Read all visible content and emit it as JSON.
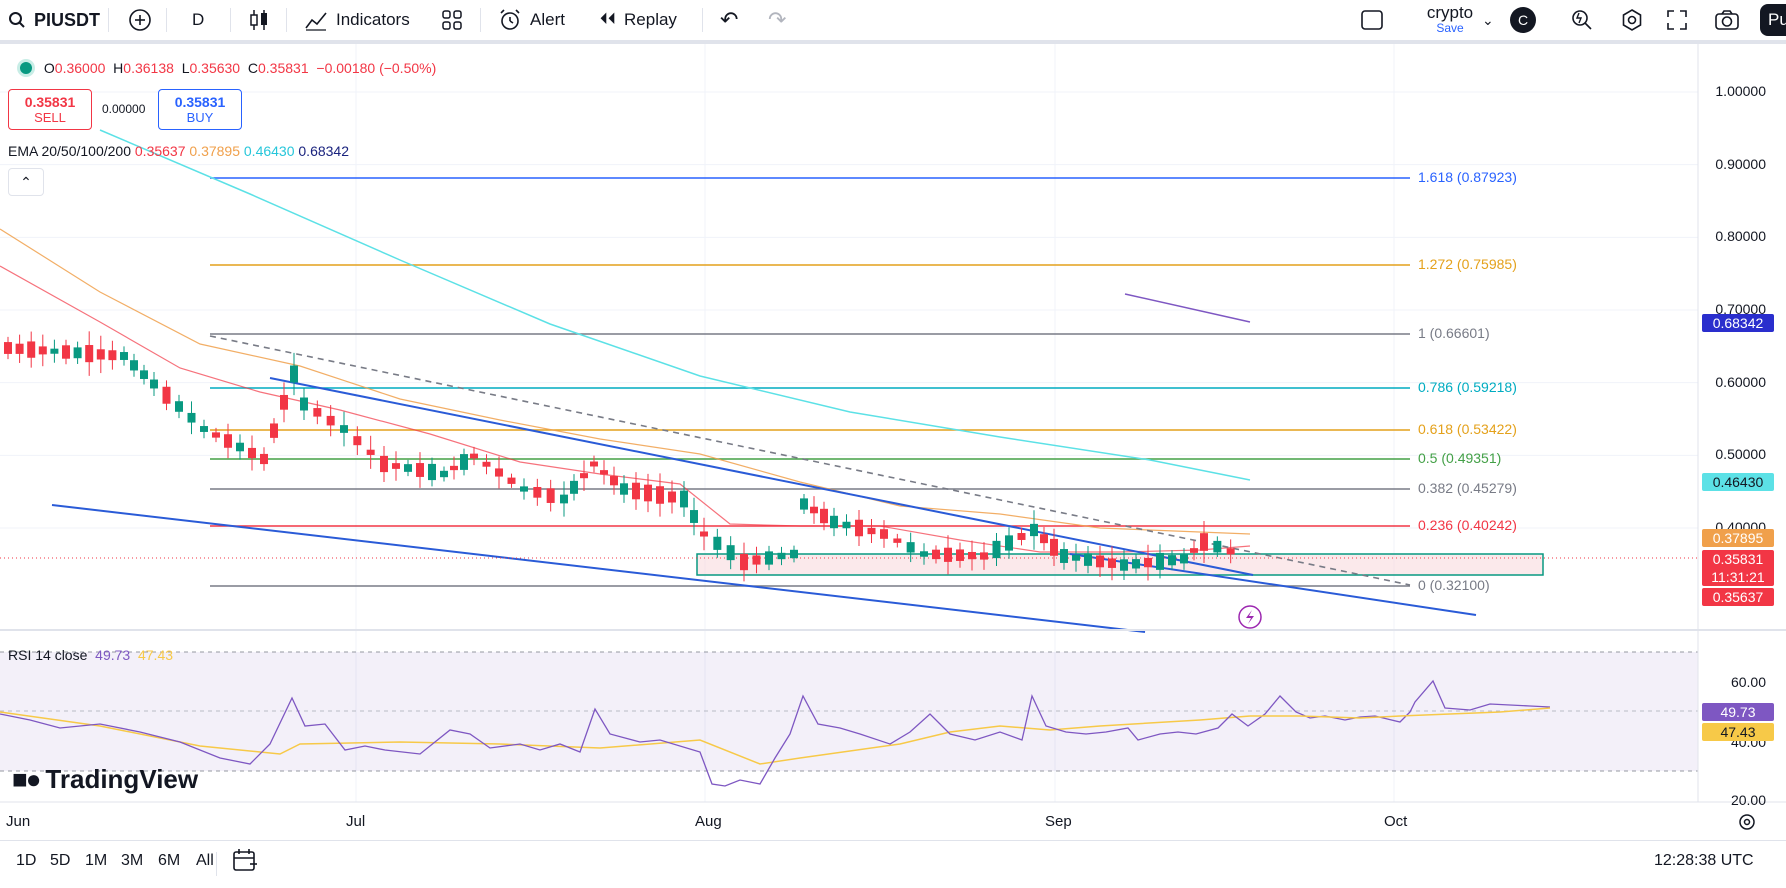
{
  "toolbar": {
    "symbol": "PIUSDT",
    "interval": "D",
    "indicators_label": "Indicators",
    "alert_label": "Alert",
    "replay_label": "Replay",
    "layout_name": "crypto",
    "save_label": "Save",
    "avatar_letter": "C",
    "publish_label": "Pu"
  },
  "legend": {
    "o_label": "O",
    "o": "0.36000",
    "h_label": "H",
    "h": "0.36138",
    "l_label": "L",
    "l": "0.35630",
    "c_label": "C",
    "c": "0.35831",
    "change": "−0.00180 (−0.50%)",
    "sell_price": "0.35831",
    "sell_label": "SELL",
    "spread": "0.00000",
    "buy_price": "0.35831",
    "buy_label": "BUY",
    "ema_label": "EMA 20/50/100/200",
    "ema20": "0.35637",
    "ema50": "0.37895",
    "ema100": "0.46430",
    "ema200": "0.68342",
    "rsi_label": "RSI 14 close",
    "rsi_value": "49.73",
    "rsi_ma": "47.43"
  },
  "colors": {
    "up": "#089981",
    "down": "#f23645",
    "ema20": "#f23645",
    "ema50": "#f0a04b",
    "ema100": "#5ce1e6",
    "ema200": "#1a237e",
    "rsi": "#7e57c2",
    "rsi_ma": "#f7c948"
  },
  "price_axis": [
    "1.00000",
    "0.90000",
    "0.80000",
    "0.70000",
    "0.60000",
    "0.50000",
    "0.40000"
  ],
  "price_tags": {
    "ema200": "0.68342",
    "ema100": "0.46430",
    "ema50": "0.37895",
    "last": "0.35831",
    "countdown": "11:31:21",
    "ema20": "0.35637"
  },
  "rsi_axis": [
    "60.00",
    "40.00",
    "20.00"
  ],
  "rsi_tags": {
    "rsi": "49.73",
    "ma": "47.43"
  },
  "fib_levels": [
    {
      "label": "1.618 (0.87923)",
      "color": "#2962ff"
    },
    {
      "label": "1.272 (0.75985)",
      "color": "#e4a11b"
    },
    {
      "label": "1 (0.66601)",
      "color": "#787b86"
    },
    {
      "label": "0.786 (0.59218)",
      "color": "#00acc1"
    },
    {
      "label": "0.618 (0.53422)",
      "color": "#e4a11b"
    },
    {
      "label": "0.5 (0.49351)",
      "color": "#43a047"
    },
    {
      "label": "0.382 (0.45279)",
      "color": "#787b86"
    },
    {
      "label": "0.236 (0.40242)",
      "color": "#f23645"
    },
    {
      "label": "0 (0.32100)",
      "color": "#787b86"
    }
  ],
  "time_axis": [
    "Jun",
    "Jul",
    "Aug",
    "Sep",
    "Oct"
  ],
  "ranges": [
    "1D",
    "5D",
    "1M",
    "3M",
    "6M",
    "All"
  ],
  "utc_time": "12:28:38 UTC",
  "brand": "TradingView"
}
